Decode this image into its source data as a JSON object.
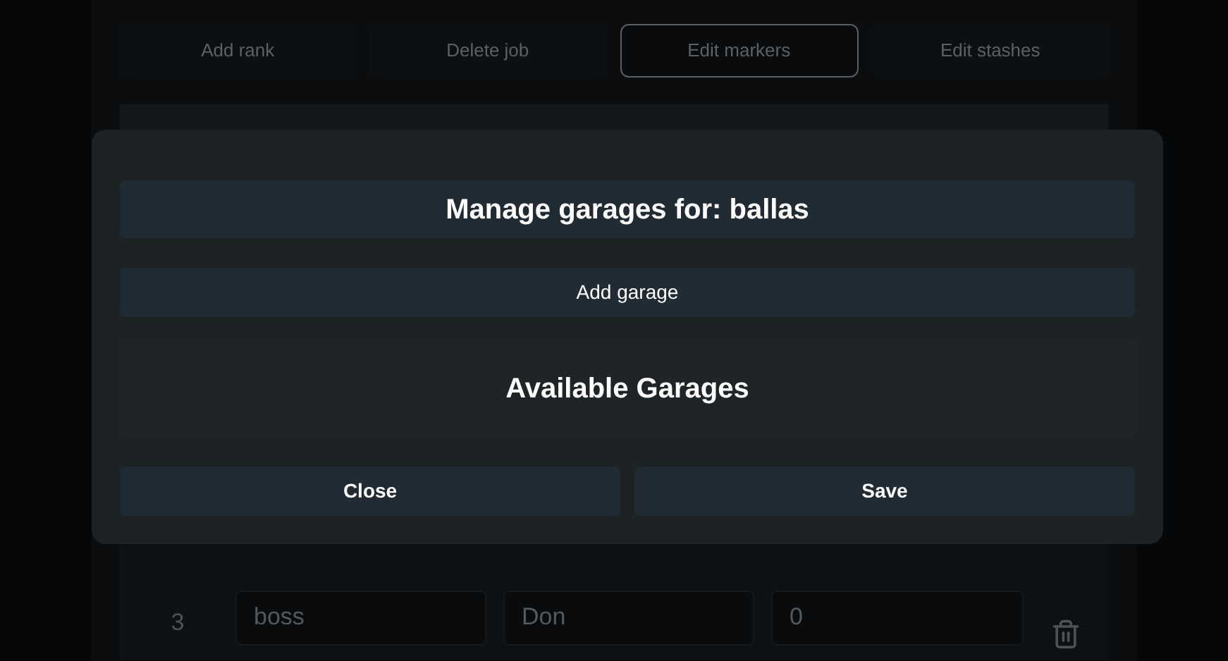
{
  "toolbar": [
    {
      "label": "Add rank",
      "selected": false
    },
    {
      "label": "Delete job",
      "selected": false
    },
    {
      "label": "Edit markers",
      "selected": true
    },
    {
      "label": "Edit stashes",
      "selected": false
    }
  ],
  "table": {
    "rows": [
      {
        "grade": "3",
        "name": "boss",
        "label": "Don",
        "salary": "0"
      }
    ]
  },
  "modal": {
    "title": "Manage garages for: ballas",
    "add_button": "Add garage",
    "section_title": "Available Garages",
    "buttons": [
      {
        "label": "Close"
      },
      {
        "label": "Save"
      }
    ]
  }
}
